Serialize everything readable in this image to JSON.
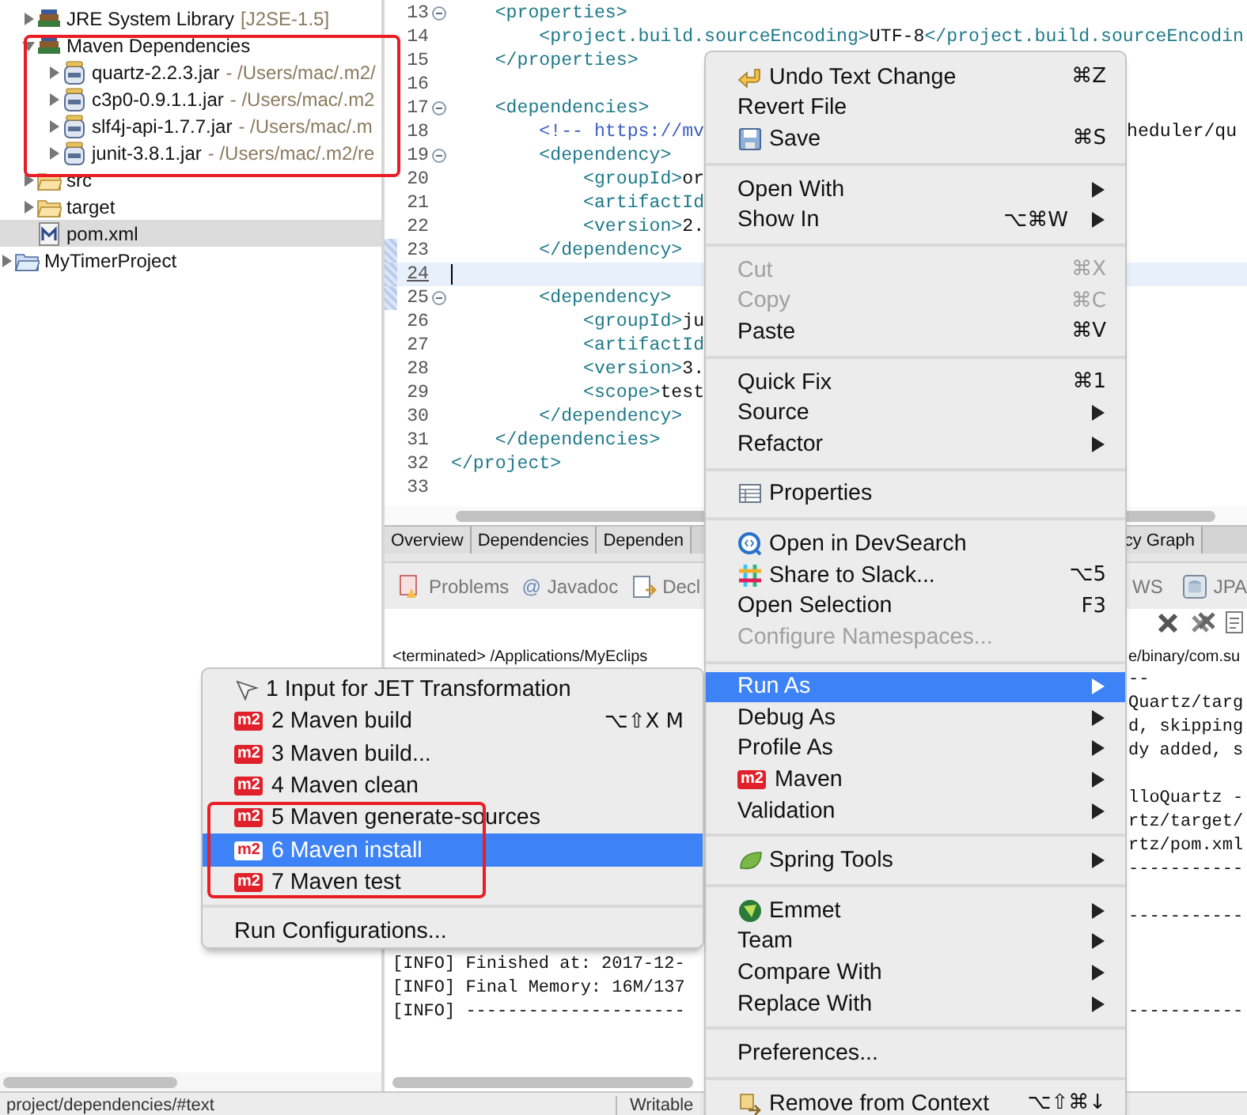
{
  "tree": [
    {
      "children": [
        {
          "label": "JRE System Library",
          "detail": "[J2SE-1.5]",
          "kind": "library",
          "expanded": false,
          "selected": false
        },
        {
          "label": "Maven Dependencies",
          "kind": "library",
          "expanded": true,
          "selected": false,
          "children": [
            {
              "label": "quartz-2.2.3.jar",
              "detail": "- /Users/mac/.m2/",
              "kind": "jar",
              "expanded": false,
              "selected": false
            },
            {
              "label": "c3p0-0.9.1.1.jar",
              "detail": "- /Users/mac/.m2",
              "kind": "jar",
              "expanded": false,
              "selected": false
            },
            {
              "label": "slf4j-api-1.7.7.jar",
              "detail": "- /Users/mac/.m",
              "kind": "jar",
              "expanded": false,
              "selected": false
            },
            {
              "label": "junit-3.8.1.jar",
              "detail": "- /Users/mac/.m2/re",
              "kind": "jar",
              "expanded": false,
              "selected": false
            }
          ]
        },
        {
          "label": "src",
          "kind": "folder",
          "expanded": false,
          "selected": false
        },
        {
          "label": "target",
          "kind": "folder",
          "expanded": false,
          "selected": false
        },
        {
          "label": "pom.xml",
          "kind": "xml",
          "selected": true
        }
      ]
    },
    {
      "label": "MyTimerProject",
      "kind": "project",
      "expanded": false,
      "selected": false
    }
  ],
  "editor": {
    "lines": [
      {
        "number": "13",
        "fold": true,
        "changed": false,
        "current": false,
        "code": "    <properties>"
      },
      {
        "number": "14",
        "fold": false,
        "changed": false,
        "current": false,
        "code": "        <project.build.sourceEncoding>UTF-8</project.build.sourceEncodin"
      },
      {
        "number": "15",
        "fold": false,
        "changed": false,
        "current": false,
        "code": "    </properties>"
      },
      {
        "number": "16",
        "fold": false,
        "changed": false,
        "current": false
      },
      {
        "number": "17",
        "fold": true,
        "changed": false,
        "current": false,
        "code": "    <dependencies>"
      },
      {
        "number": "18",
        "fold": false,
        "changed": false,
        "current": false,
        "code": "        <!-- https://mv",
        "right": "heduler/qu"
      },
      {
        "number": "19",
        "fold": true,
        "changed": false,
        "current": false,
        "code": "        <dependency>"
      },
      {
        "number": "20",
        "fold": false,
        "changed": false,
        "current": false,
        "code": "            <groupId>or"
      },
      {
        "number": "21",
        "fold": false,
        "changed": false,
        "current": false,
        "code": "            <artifactId"
      },
      {
        "number": "22",
        "fold": false,
        "changed": false,
        "current": false,
        "code": "            <version>2."
      },
      {
        "number": "23",
        "fold": false,
        "changed": true,
        "current": false,
        "code": "        </dependency>"
      },
      {
        "number": "24",
        "fold": false,
        "changed": true,
        "current": true
      },
      {
        "number": "25",
        "fold": true,
        "changed": true,
        "current": false,
        "code": "        <dependency>"
      },
      {
        "number": "26",
        "fold": false,
        "changed": false,
        "current": false,
        "code": "            <groupId>ju"
      },
      {
        "number": "27",
        "fold": false,
        "changed": false,
        "current": false,
        "code": "            <artifactId"
      },
      {
        "number": "28",
        "fold": false,
        "changed": false,
        "current": false,
        "code": "            <version>3."
      },
      {
        "number": "29",
        "fold": false,
        "changed": false,
        "current": false,
        "code": "            <scope>test"
      },
      {
        "number": "30",
        "fold": false,
        "changed": false,
        "current": false,
        "code": "        </dependency>"
      },
      {
        "number": "31",
        "fold": false,
        "changed": false,
        "current": false,
        "code": "    </dependencies>"
      },
      {
        "number": "32",
        "fold": false,
        "changed": false,
        "current": false,
        "code": "</project>"
      },
      {
        "number": "33",
        "fold": false,
        "changed": false,
        "current": false
      }
    ],
    "tabs": [
      "Overview",
      "Dependencies",
      "Dependen",
      "cy Graph"
    ]
  },
  "views": {
    "tabs": [
      {
        "label": "Problems",
        "kind": "problems"
      },
      {
        "label": "Javadoc",
        "kind": "glyph",
        "glyph": "@"
      },
      {
        "label": "Decl",
        "kind": "declaration"
      },
      {
        "label": "WS",
        "kind": "plain"
      },
      {
        "label": "JPA",
        "kind": "jpa"
      }
    ],
    "console": [
      {
        "kind": "label",
        "left": "<terminated> /Applications/MyEclips",
        "right": "e/binary/com.su"
      },
      {
        "kind": "output",
        "right": "--"
      },
      {
        "kind": "output",
        "right": "Quartz/targ"
      },
      {
        "kind": "output",
        "right": "d, skipping"
      },
      {
        "kind": "output",
        "right": "dy added, s"
      },
      {
        "kind": "blank"
      },
      {
        "kind": "output",
        "right": "lloQuartz -"
      },
      {
        "kind": "output",
        "right": "rtz/target/"
      },
      {
        "kind": "output",
        "right": "rtz/pom.xml"
      },
      {
        "kind": "output",
        "right": "-----------"
      },
      {
        "kind": "blank"
      },
      {
        "kind": "output",
        "right": "-----------"
      },
      {
        "kind": "blank"
      },
      {
        "kind": "output",
        "left": "[INFO] Finished at: 2017-12-"
      },
      {
        "kind": "output",
        "left": "[INFO] Final Memory: 16M/137"
      },
      {
        "kind": "output",
        "left": "[INFO] ---------------------",
        "right": "-----------"
      }
    ]
  },
  "menu": {
    "items": [
      {
        "kind": "undo",
        "label": "Undo Text Change",
        "shortcut": "⌘Z",
        "disabled": false,
        "selected": false,
        "submenu": false
      },
      {
        "kind": "text",
        "label": "Revert File",
        "disabled": false,
        "selected": false,
        "submenu": false
      },
      {
        "kind": "save",
        "label": "Save",
        "shortcut": "⌘S",
        "disabled": false,
        "selected": false,
        "submenu": false
      },
      {
        "kind": "separator"
      },
      {
        "kind": "text",
        "label": "Open With",
        "disabled": false,
        "selected": false,
        "submenu": true
      },
      {
        "kind": "text",
        "label": "Show In",
        "shortcut": "⌥⌘W",
        "disabled": false,
        "selected": false,
        "submenu": true
      },
      {
        "kind": "separator"
      },
      {
        "kind": "text",
        "label": "Cut",
        "shortcut": "⌘X",
        "disabled": true,
        "selected": false,
        "submenu": false
      },
      {
        "kind": "text",
        "label": "Copy",
        "shortcut": "⌘C",
        "disabled": true,
        "selected": false,
        "submenu": false
      },
      {
        "kind": "text",
        "label": "Paste",
        "shortcut": "⌘V",
        "disabled": false,
        "selected": false,
        "submenu": false
      },
      {
        "kind": "separator"
      },
      {
        "kind": "text",
        "label": "Quick Fix",
        "shortcut": "⌘1",
        "disabled": false,
        "selected": false,
        "submenu": false
      },
      {
        "kind": "text",
        "label": "Source",
        "disabled": false,
        "selected": false,
        "submenu": true
      },
      {
        "kind": "text",
        "label": "Refactor",
        "disabled": false,
        "selected": false,
        "submenu": true
      },
      {
        "kind": "separator"
      },
      {
        "kind": "properties",
        "label": "Properties",
        "disabled": false,
        "selected": false,
        "submenu": false
      },
      {
        "kind": "separator"
      },
      {
        "kind": "search",
        "label": "Open in DevSearch",
        "disabled": false,
        "selected": false,
        "submenu": false
      },
      {
        "kind": "share",
        "label": "Share to Slack...",
        "shortcut": "⌥5",
        "disabled": false,
        "selected": false,
        "submenu": false
      },
      {
        "kind": "text",
        "label": "Open Selection",
        "shortcut": "F3",
        "disabled": false,
        "selected": false,
        "submenu": false
      },
      {
        "kind": "text",
        "label": "Configure Namespaces...",
        "disabled": true,
        "selected": false,
        "submenu": false
      },
      {
        "kind": "separator"
      },
      {
        "kind": "text",
        "label": "Run As",
        "disabled": false,
        "selected": true,
        "submenu": true
      },
      {
        "kind": "text",
        "label": "Debug As",
        "disabled": false,
        "selected": false,
        "submenu": true
      },
      {
        "kind": "text",
        "label": "Profile As",
        "disabled": false,
        "selected": false,
        "submenu": true
      },
      {
        "kind": "badge",
        "badge": "m2",
        "label": "Maven",
        "disabled": false,
        "selected": false,
        "submenu": true
      },
      {
        "kind": "text",
        "label": "Validation",
        "disabled": false,
        "selected": false,
        "submenu": true
      },
      {
        "kind": "separator"
      },
      {
        "kind": "leaf",
        "label": "Spring Tools",
        "disabled": false,
        "selected": false,
        "submenu": true
      },
      {
        "kind": "separator"
      },
      {
        "kind": "emmet",
        "label": "Emmet",
        "disabled": false,
        "selected": false,
        "submenu": true
      },
      {
        "kind": "text",
        "label": "Team",
        "disabled": false,
        "selected": false,
        "submenu": true
      },
      {
        "kind": "text",
        "label": "Compare With",
        "disabled": false,
        "selected": false,
        "submenu": true
      },
      {
        "kind": "text",
        "label": "Replace With",
        "disabled": false,
        "selected": false,
        "submenu": true
      },
      {
        "kind": "separator"
      },
      {
        "kind": "text",
        "label": "Preferences...",
        "disabled": false,
        "selected": false,
        "submenu": false
      },
      {
        "kind": "separator"
      },
      {
        "kind": "remove",
        "label": "Remove from Context",
        "shortcut": "⌥⇧⌘↓",
        "disabled": false,
        "selected": false,
        "submenu": false
      }
    ]
  },
  "submenu": {
    "items": [
      {
        "kind": "cursor",
        "label": "1 Input for JET Transformation",
        "disabled": false,
        "selected": false,
        "submenu": false,
        "highlighted": false
      },
      {
        "kind": "badge",
        "badge": "m2",
        "label": "2 Maven build",
        "shortcut": "⌥⇧X M",
        "disabled": false,
        "selected": false,
        "submenu": false,
        "highlighted": false
      },
      {
        "kind": "badge",
        "badge": "m2",
        "label": "3 Maven build...",
        "disabled": false,
        "selected": false,
        "submenu": false,
        "highlighted": false
      },
      {
        "kind": "badge",
        "badge": "m2",
        "label": "4 Maven clean",
        "disabled": false,
        "selected": false,
        "submenu": false,
        "highlighted": false
      },
      {
        "kind": "badge",
        "badge": "m2",
        "label": "5 Maven generate-sources",
        "disabled": false,
        "selected": false,
        "submenu": false,
        "highlighted": true
      },
      {
        "kind": "badge",
        "badge": "m2",
        "label": "6 Maven install",
        "disabled": false,
        "selected": true,
        "submenu": false,
        "highlighted": true
      },
      {
        "kind": "badge",
        "badge": "m2",
        "label": "7 Maven test",
        "disabled": false,
        "selected": false,
        "submenu": false,
        "highlighted": true
      },
      {
        "kind": "separator"
      },
      {
        "kind": "text",
        "label": "Run Configurations...",
        "disabled": false,
        "selected": false,
        "submenu": false,
        "highlighted": false
      }
    ]
  },
  "status_bar": {
    "path": "project/dependencies/#text",
    "mode": "Writable"
  }
}
